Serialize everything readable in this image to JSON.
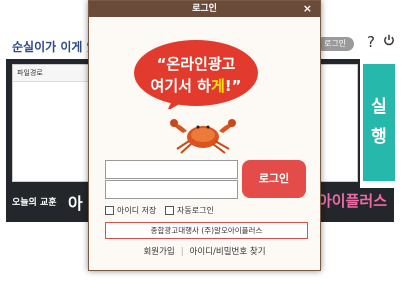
{
  "background": {
    "title": "순실이가 이게 있",
    "login_button": "로그인",
    "help_icon": "?",
    "list_header": "파일경로",
    "side_label_1": "실",
    "side_label_2": "행",
    "lesson_label": "오늘의 교훈",
    "lesson_partial": "아",
    "brand_partial": "아이플러스"
  },
  "modal": {
    "title": "로그인",
    "close": "×",
    "banner_line1": "“온라인광고",
    "banner_line2_a": "여기서 하",
    "banner_line2_b": "게",
    "banner_line2_c": "!”",
    "login_button": "로그인",
    "save_id_label": "아이디 저장",
    "auto_login_label": "자동로그인",
    "ad_text": "종합광고대행사 (주)알오아이플러스",
    "signup_link": "회원가입",
    "find_link": "아이디/비밀번호 찾기",
    "colors": {
      "accent": "#e44c4a",
      "titlebar": "#6a4a38",
      "side": "#27b8ac"
    }
  }
}
